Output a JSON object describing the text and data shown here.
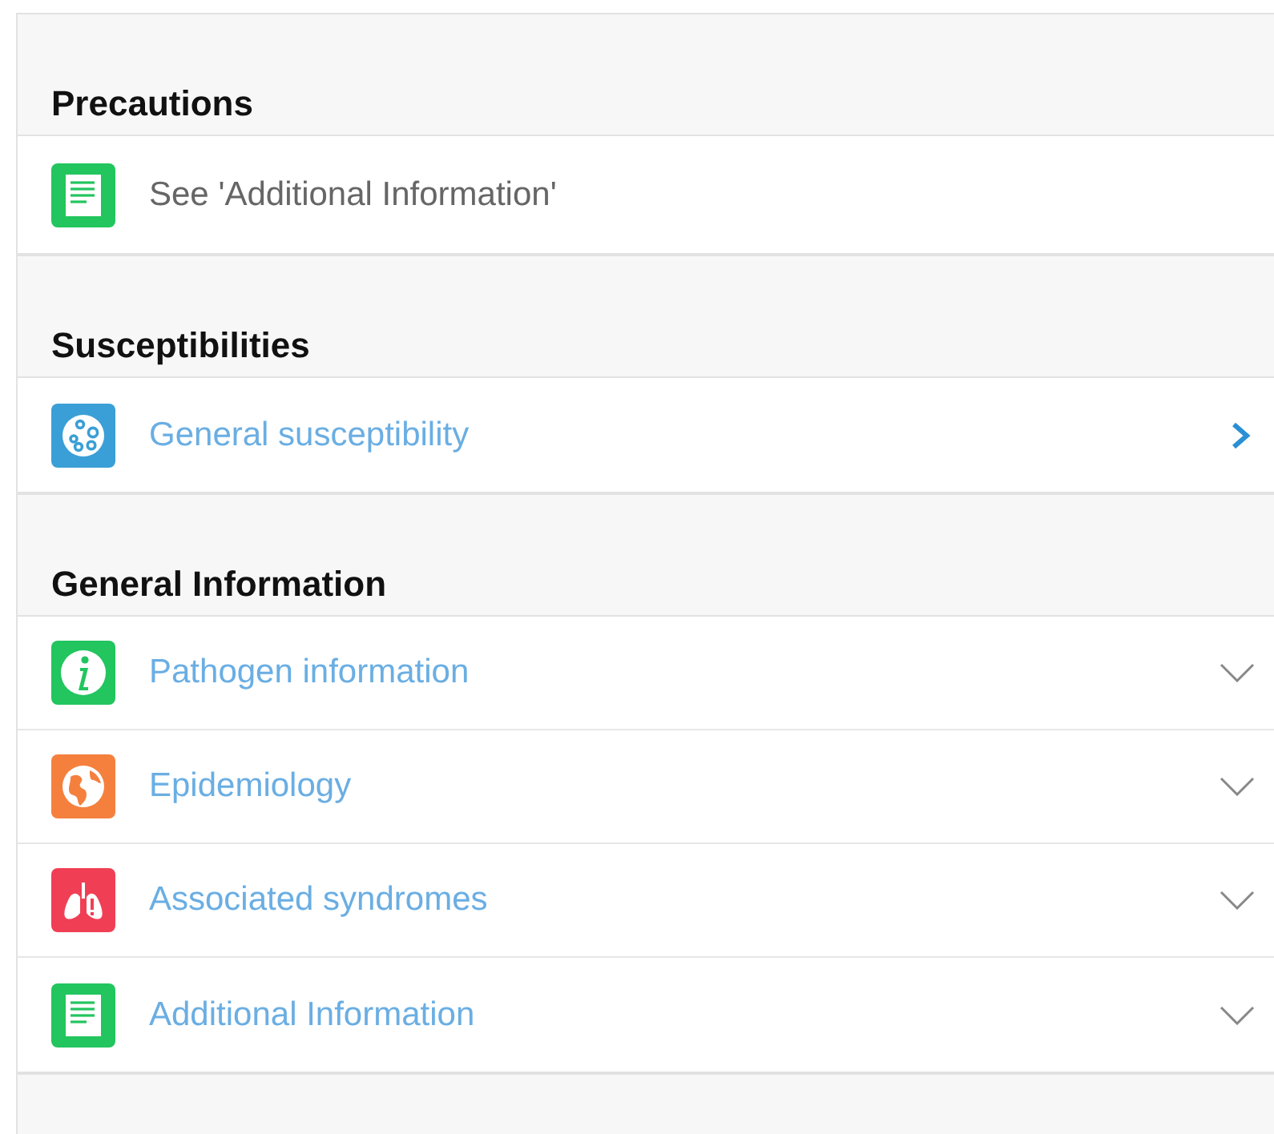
{
  "sections": [
    {
      "title": "Precautions",
      "items": [
        {
          "label": "See 'Additional Information'",
          "kind": "note"
        }
      ]
    },
    {
      "title": "Susceptibilities",
      "items": [
        {
          "label": "General susceptibility",
          "kind": "link"
        }
      ]
    },
    {
      "title": "General Information",
      "items": [
        {
          "label": "Pathogen information",
          "kind": "expandable",
          "expanded": false
        },
        {
          "label": "Epidemiology",
          "kind": "expandable",
          "expanded": false
        },
        {
          "label": "Associated syndromes",
          "kind": "expandable",
          "expanded": false
        },
        {
          "label": "Additional Information",
          "kind": "expandable",
          "expanded": false
        }
      ]
    }
  ]
}
